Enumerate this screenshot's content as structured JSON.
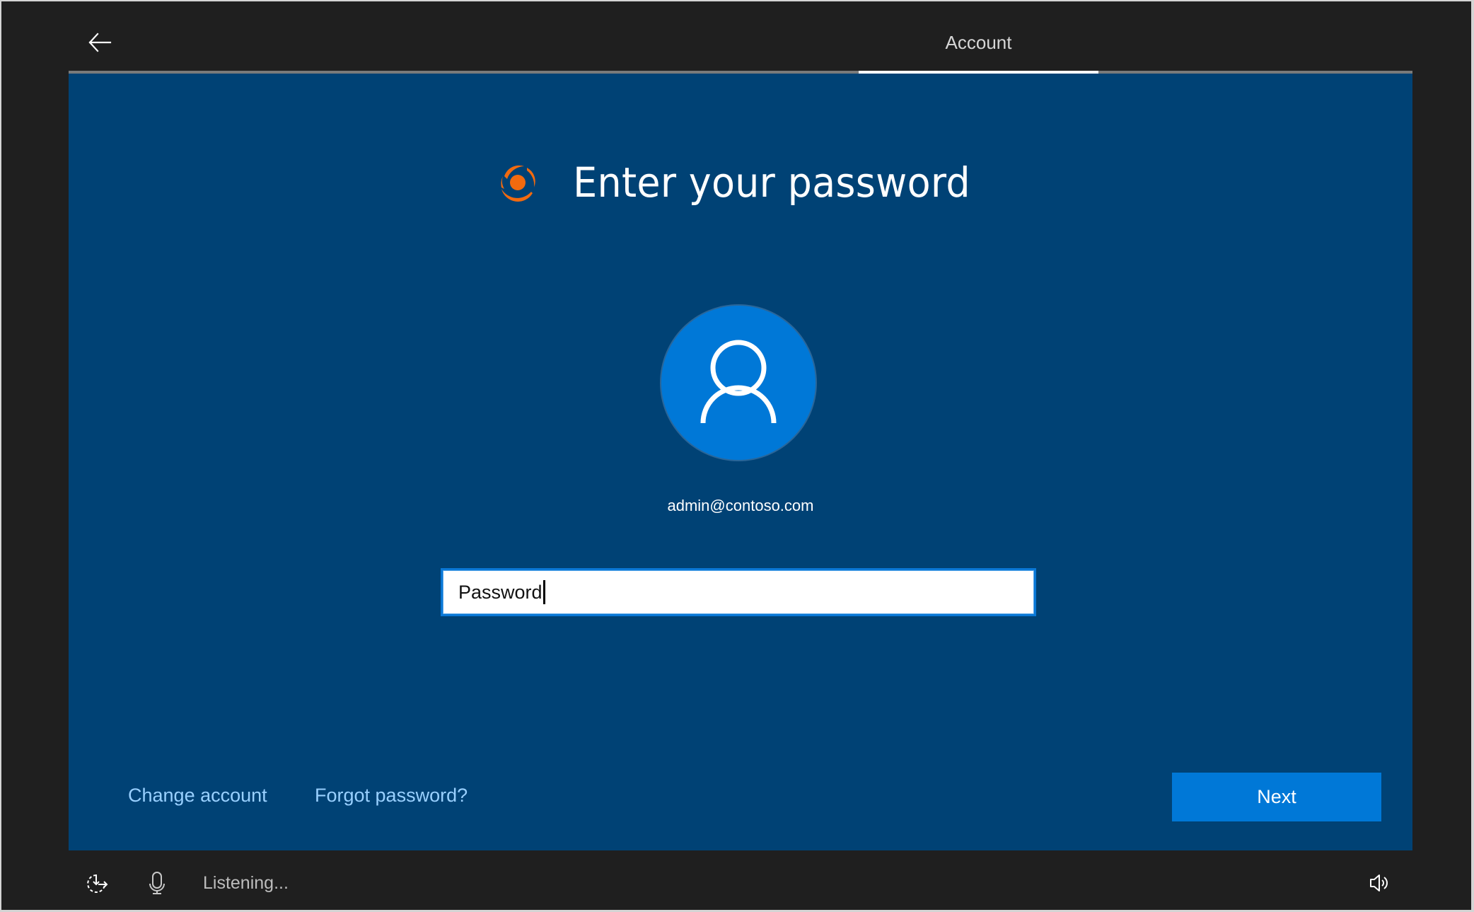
{
  "header": {
    "back_label": "Back",
    "step_title": "Account",
    "progress": {
      "current_step_segment": "Account"
    }
  },
  "main": {
    "logo_icon": "orange-swirl-logo",
    "title": "Enter your password",
    "avatar_icon": "person-icon",
    "account_email": "admin@contoso.com",
    "password_field": {
      "placeholder": "Password",
      "value": "",
      "focused": true
    },
    "links": {
      "change_account": "Change account",
      "forgot_password": "Forgot password?"
    },
    "next_label": "Next"
  },
  "footer": {
    "ease_of_access_icon": "ease-of-access-icon",
    "microphone_icon": "microphone-icon",
    "status_text": "Listening...",
    "volume_icon": "volume-icon"
  },
  "colors": {
    "panel_bg": "#004275",
    "chrome_bg": "#1f1f1f",
    "accent": "#0078d7",
    "link": "#99d0ff",
    "logo": "#f26a0f"
  }
}
